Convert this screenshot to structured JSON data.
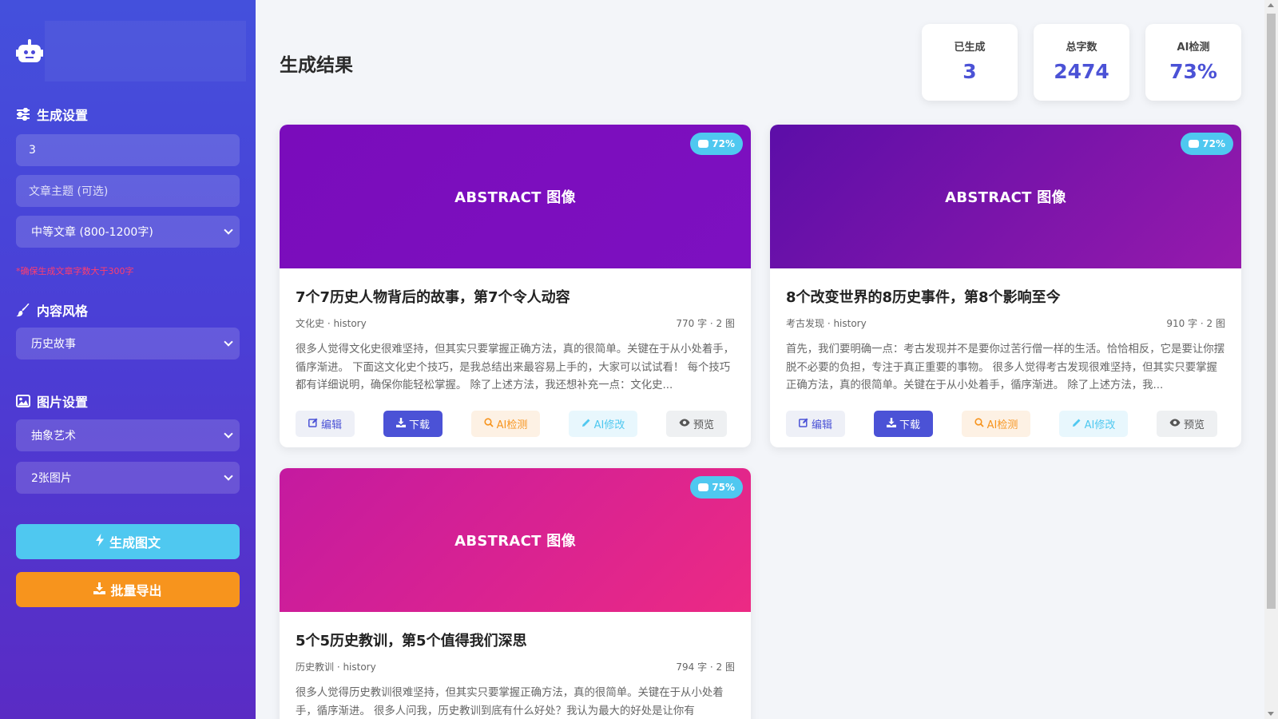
{
  "sidebar": {
    "logo_icon": "robot-icon",
    "generation_settings": {
      "title": "生成设置",
      "count_value": "3",
      "topic_placeholder": "文章主题 (可选)",
      "length_selected": "中等文章 (800-1200字)",
      "hint": "*确保生成文章字数大于300字"
    },
    "content_style": {
      "title": "内容风格",
      "style_selected": "历史故事"
    },
    "image_settings": {
      "title": "图片设置",
      "image_style_selected": "抽象艺术",
      "image_count_selected": "2张图片"
    },
    "generate_label": "生成图文",
    "export_label": "批量导出"
  },
  "main": {
    "title": "生成结果",
    "stats": [
      {
        "label": "已生成",
        "value": "3"
      },
      {
        "label": "总字数",
        "value": "2474"
      },
      {
        "label": "AI检测",
        "value": "73%"
      }
    ],
    "actions": {
      "edit": "编辑",
      "download": "下载",
      "ai_detect": "AI检测",
      "ai_fix": "AI修改",
      "preview": "预览"
    },
    "cards": [
      {
        "banner_text": "ABSTRACT 图像",
        "badge": "72%",
        "banner_colors": [
          "#7a0cbb",
          "#7d10c0"
        ],
        "title": "7个7历史人物背后的故事，第7个令人动容",
        "category": "文化史 · history",
        "stats": "770 字 · 2 图",
        "excerpt": "很多人觉得文化史很难坚持，但其实只要掌握正确方法，真的很简单。关键在于从小处着手，循序渐进。 下面这文化史个技巧，是我总结出来最容易上手的，大家可以试试看！ 每个技巧都有详细说明，确保你能轻松掌握。 除了上述方法，我还想补充一点：文化史..."
      },
      {
        "banner_text": "ABSTRACT 图像",
        "badge": "72%",
        "banner_colors": [
          "#5c0ea8",
          "#961aac"
        ],
        "title": "8个改变世界的8历史事件，第8个影响至今",
        "category": "考古发现 · history",
        "stats": "910 字 · 2 图",
        "excerpt": "首先，我们要明确一点：考古发现并不是要你过苦行僧一样的生活。恰恰相反，它是要让你摆脱不必要的负担，专注于真正重要的事物。 很多人觉得考古发现很难坚持，但其实只要掌握正确方法，真的很简单。关键在于从小处着手，循序渐进。 除了上述方法，我..."
      },
      {
        "banner_text": "ABSTRACT 图像",
        "badge": "75%",
        "banner_colors": [
          "#c41aa0",
          "#ec2a84"
        ],
        "title": "5个5历史教训，第5个值得我们深思",
        "category": "历史教训 · history",
        "stats": "794 字 · 2 图",
        "excerpt": "很多人觉得历史教训很难坚持，但其实只要掌握正确方法，真的很简单。关键在于从小处着手，循序渐进。 很多人问我，历史教训到底有什么好处？我认为最大的好处是让你有"
      }
    ]
  }
}
